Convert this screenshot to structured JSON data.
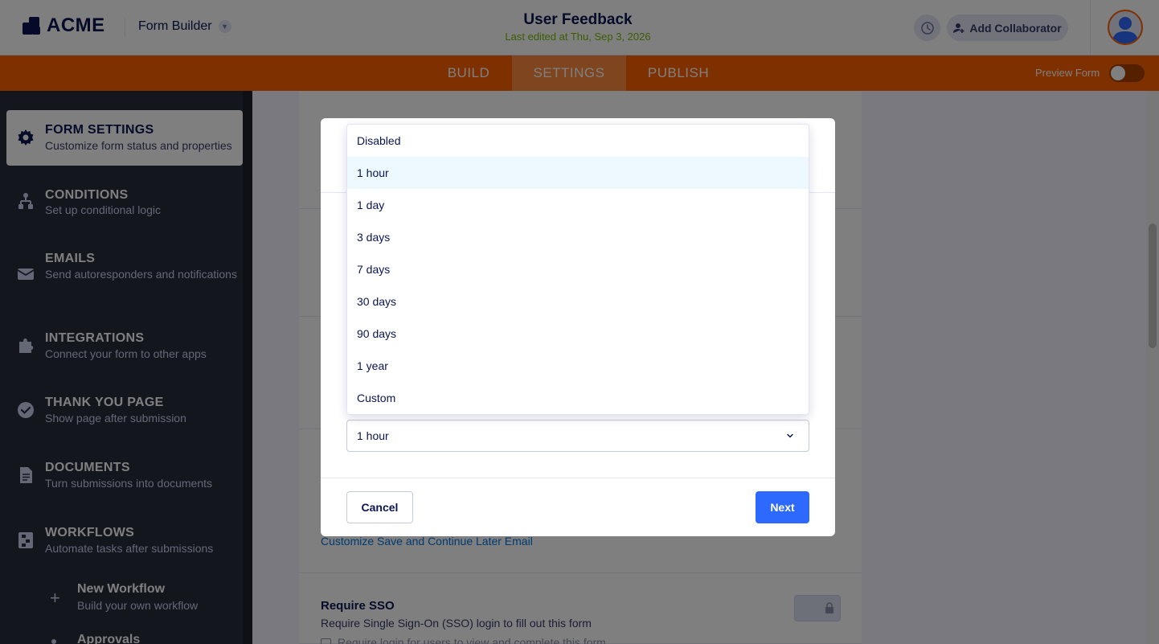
{
  "header": {
    "logo_text": "ACME",
    "app_name": "Form Builder",
    "form_title": "User Feedback",
    "last_edited": "Last edited at Thu, Sep 3, 2026",
    "collab_label": "Add Collaborator"
  },
  "navbar": {
    "tabs": [
      {
        "label": "BUILD",
        "active": false
      },
      {
        "label": "SETTINGS",
        "active": true
      },
      {
        "label": "PUBLISH",
        "active": false
      }
    ],
    "preview_label": "Preview Form",
    "preview_on": false
  },
  "sidebar": {
    "items": [
      {
        "title": "FORM SETTINGS",
        "desc": "Customize form status and properties",
        "icon": "gear-icon",
        "active": true
      },
      {
        "title": "CONDITIONS",
        "desc": "Set up conditional logic",
        "icon": "conditions-icon"
      },
      {
        "title": "EMAILS",
        "desc": "Send autoresponders and notifications",
        "icon": "envelope-icon"
      },
      {
        "title": "INTEGRATIONS",
        "desc": "Connect your form to other apps",
        "icon": "puzzle-icon"
      },
      {
        "title": "THANK YOU PAGE",
        "desc": "Show page after submission",
        "icon": "check-circle-icon"
      },
      {
        "title": "DOCUMENTS",
        "desc": "Turn submissions into documents",
        "icon": "document-icon"
      },
      {
        "title": "WORKFLOWS",
        "desc": "Automate tasks after submissions",
        "icon": "workflow-icon"
      }
    ],
    "sub_items": [
      {
        "title": "New Workflow",
        "desc": "Build your own workflow",
        "icon": "plus-icon"
      },
      {
        "title": "Approvals",
        "icon": "bullet-icon"
      }
    ]
  },
  "main": {
    "link_text": "Customize Save and Continue Later Email",
    "sso": {
      "title": "Require SSO",
      "desc": "Require Single Sign-On (SSO) login to fill out this form",
      "checkbox_label": "Require login for users to view and complete this form"
    }
  },
  "modal": {
    "options": [
      "Disabled",
      "1 hour",
      "1 day",
      "3 days",
      "7 days",
      "30 days",
      "90 days",
      "1 year",
      "Custom"
    ],
    "selected_value": "1 hour",
    "cancel_label": "Cancel",
    "next_label": "Next"
  },
  "colors": {
    "accent_orange": "#ff6100",
    "primary_blue": "#2e69ff",
    "sidebar_bg": "#292d3c",
    "edited_green": "#78bb07"
  }
}
